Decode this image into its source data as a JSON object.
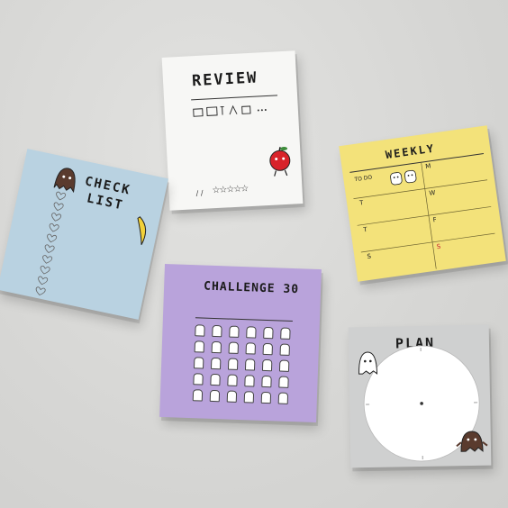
{
  "pads": {
    "review": {
      "title": "REVIEW",
      "color": "#f7f7f5",
      "rating_prefix": "/ /",
      "stars": 5
    },
    "checklist": {
      "title_line1": "CHECK",
      "title_line2": "LIST",
      "color": "#b9d2e1",
      "hearts": 10
    },
    "weekly": {
      "title": "WEEKLY",
      "color": "#f3e27a",
      "todo": "TO DO",
      "days": [
        "M",
        "T",
        "W",
        "T",
        "F",
        "S",
        "S"
      ]
    },
    "challenge": {
      "title": "CHALLENGE 30",
      "color": "#b9a3db",
      "cells": 30
    },
    "plan": {
      "title": "PLAN",
      "color": "#cfd0d0"
    }
  }
}
